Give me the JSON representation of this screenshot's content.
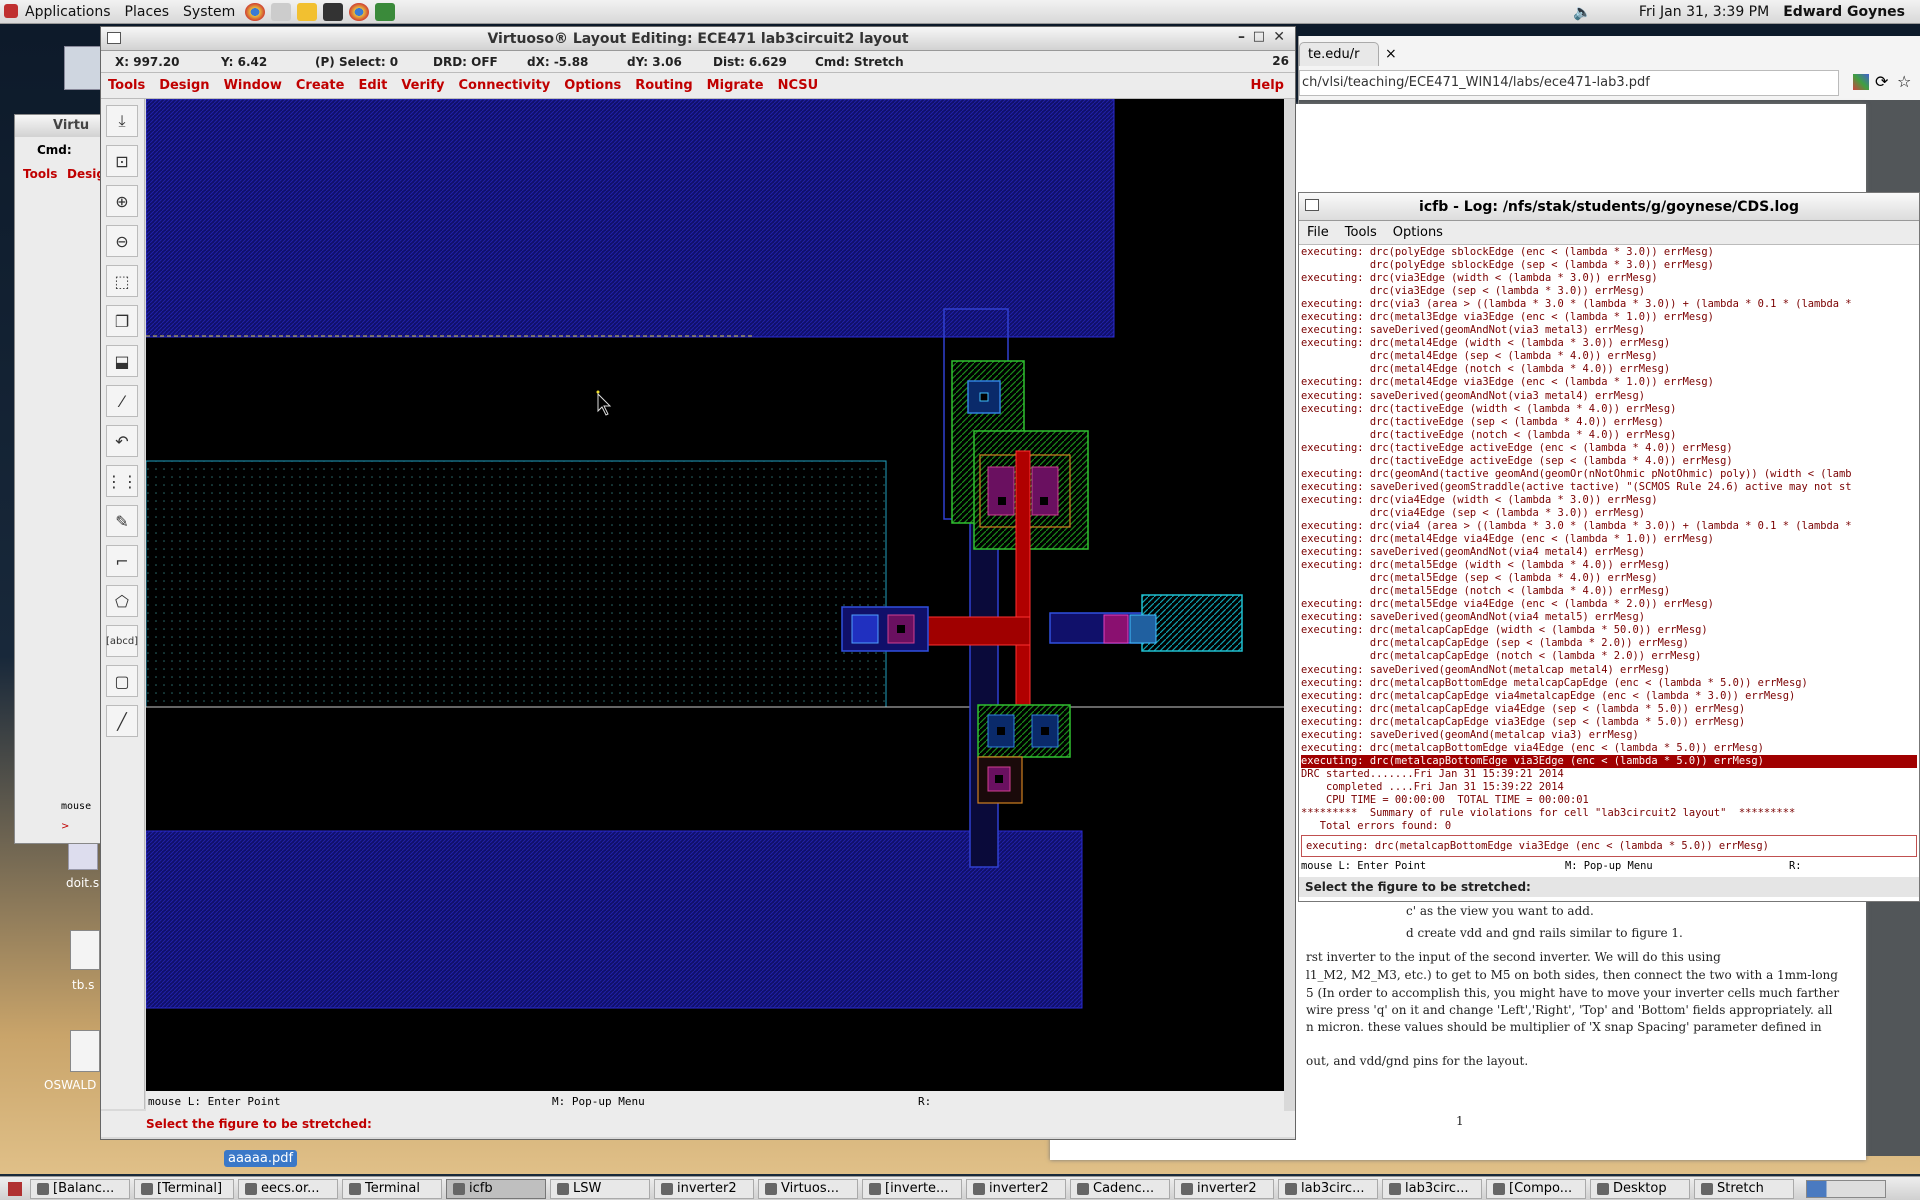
{
  "top_panel": {
    "menus": [
      "Applications",
      "Places",
      "System"
    ],
    "clock": "Fri Jan 31,  3:39 PM",
    "user": "Edward Goynes"
  },
  "browser": {
    "tab_label": "te.edu/r",
    "tab_close": "×",
    "url": "ch/vlsi/teaching/ECE471_WIN14/labs/ece471-lab3.pdf"
  },
  "pdf": {
    "lines": [
      "c' as the view you want to add.",
      "d create vdd and gnd rails similar to figure 1.",
      "rst inverter to the input of the second inverter. We will do this using",
      "l1_M2, M2_M3, etc.) to get to M5 on both sides, then connect the two with a 1mm-long",
      "5 (In order to accomplish this, you might have to move your inverter cells much farther",
      "wire press 'q' on it and change 'Left','Right', 'Top' and 'Bottom' fields appropriately. all",
      "n micron. these values should be multiplier of 'X snap Spacing' parameter defined in",
      "out, and vdd/gnd pins for the layout."
    ],
    "page_number": "1"
  },
  "log_window": {
    "title": "icfb - Log: /nfs/stak/students/g/goynese/CDS.log",
    "menus": [
      "File",
      "Tools",
      "Options"
    ],
    "lines": [
      "executing: drc(polyEdge sblockEdge (enc < (lambda * 3.0)) errMesg)",
      "           drc(polyEdge sblockEdge (sep < (lambda * 3.0)) errMesg)",
      "executing: drc(via3Edge (width < (lambda * 3.0)) errMesg)",
      "           drc(via3Edge (sep < (lambda * 3.0)) errMesg)",
      "executing: drc(via3 (area > ((lambda * 3.0 * (lambda * 3.0)) + (lambda * 0.1 * (lambda *",
      "executing: drc(metal3Edge via3Edge (enc < (lambda * 1.0)) errMesg)",
      "executing: saveDerived(geomAndNot(via3 metal3) errMesg)",
      "executing: drc(metal4Edge (width < (lambda * 3.0)) errMesg)",
      "           drc(metal4Edge (sep < (lambda * 4.0)) errMesg)",
      "           drc(metal4Edge (notch < (lambda * 4.0)) errMesg)",
      "executing: drc(metal4Edge via3Edge (enc < (lambda * 1.0)) errMesg)",
      "executing: saveDerived(geomAndNot(via3 metal4) errMesg)",
      "executing: drc(tactiveEdge (width < (lambda * 4.0)) errMesg)",
      "           drc(tactiveEdge (sep < (lambda * 4.0)) errMesg)",
      "           drc(tactiveEdge (notch < (lambda * 4.0)) errMesg)",
      "executing: drc(tactiveEdge activeEdge (enc < (lambda * 4.0)) errMesg)",
      "           drc(tactiveEdge activeEdge (sep < (lambda * 4.0)) errMesg)",
      "executing: drc(geomAnd(tactive geomAnd(geomOr(nNotOhmic pNotOhmic) poly)) (width < (lamb",
      "executing: saveDerived(geomStraddle(active tactive) \"(SCMOS Rule 24.6) active may not st",
      "executing: drc(via4Edge (width < (lambda * 3.0)) errMesg)",
      "           drc(via4Edge (sep < (lambda * 3.0)) errMesg)",
      "executing: drc(via4 (area > ((lambda * 3.0 * (lambda * 3.0)) + (lambda * 0.1 * (lambda *",
      "executing: drc(metal4Edge via4Edge (enc < (lambda * 1.0)) errMesg)",
      "executing: saveDerived(geomAndNot(via4 metal4) errMesg)",
      "executing: drc(metal5Edge (width < (lambda * 4.0)) errMesg)",
      "           drc(metal5Edge (sep < (lambda * 4.0)) errMesg)",
      "           drc(metal5Edge (notch < (lambda * 4.0)) errMesg)",
      "executing: drc(metal5Edge via4Edge (enc < (lambda * 2.0)) errMesg)",
      "executing: saveDerived(geomAndNot(via4 metal5) errMesg)",
      "executing: drc(metalcapCapEdge (width < (lambda * 50.0)) errMesg)",
      "           drc(metalcapCapEdge (sep < (lambda * 2.0)) errMesg)",
      "           drc(metalcapCapEdge (notch < (lambda * 2.0)) errMesg)",
      "executing: saveDerived(geomAndNot(metalcap metal4) errMesg)",
      "executing: drc(metalcapBottomEdge metalcapCapEdge (enc < (lambda * 5.0)) errMesg)",
      "executing: drc(metalcapCapEdge via4metalcapEdge (enc < (lambda * 3.0)) errMesg)",
      "executing: drc(metalcapCapEdge via4Edge (sep < (lambda * 5.0)) errMesg)",
      "executing: drc(metalcapCapEdge via3Edge (sep < (lambda * 5.0)) errMesg)",
      "executing: saveDerived(geomAnd(metalcap via3) errMesg)",
      "executing: drc(metalcapBottomEdge via4Edge (enc < (lambda * 5.0)) errMesg)"
    ],
    "highlighted_line": "executing: drc(metalcapBottomEdge via3Edge (enc < (lambda * 5.0)) errMesg)",
    "summary_lines": [
      "DRC started.......Fri Jan 31 15:39:21 2014",
      "    completed ....Fri Jan 31 15:39:22 2014",
      "    CPU TIME = 00:00:00  TOTAL TIME = 00:00:01",
      "*********  Summary of rule violations for cell \"lab3circuit2 layout\"  *********",
      "   Total errors found: 0"
    ],
    "input_value": "executing: drc(metalcapBottomEdge via3Edge (enc < (lambda * 5.0)) errMesg)",
    "mouse_l": "mouse L: Enter Point",
    "mouse_m": "M: Pop-up Menu",
    "mouse_r": "R:",
    "prompt": "Select the figure to be stretched:"
  },
  "small_window": {
    "title": "Virtu",
    "cmd_label": "Cmd:",
    "menus": [
      "Tools",
      "Design"
    ],
    "mouse_label": "mouse",
    "prompt_char": ">"
  },
  "virtuoso": {
    "title": "Virtuoso® Layout Editing: ECE471 lab3circuit2 layout",
    "status": {
      "x": "X: 997.20",
      "y": "Y: 6.42",
      "select": "(P) Select: 0",
      "drd": "DRD: OFF",
      "dx": "dX: -5.88",
      "dy": "dY: 3.06",
      "dist": "Dist: 6.629",
      "cmd": "Cmd: Stretch",
      "count": "26"
    },
    "menus": [
      "Tools",
      "Design",
      "Window",
      "Create",
      "Edit",
      "Verify",
      "Connectivity",
      "Options",
      "Routing",
      "Migrate",
      "NCSU"
    ],
    "help": "Help",
    "mouse_l": "mouse L: Enter Point",
    "mouse_m": "M: Pop-up Menu",
    "mouse_r": "R:",
    "prompt": "Select the figure to be stretched:",
    "toolbar_labels": {
      "label_tool": "[abcd]"
    }
  },
  "desktop_icons": [
    {
      "label": "doit.s"
    },
    {
      "label": "tb.s"
    },
    {
      "label": "OSWALD"
    },
    {
      "label": "aaaaa.pdf"
    }
  ],
  "taskbar": [
    {
      "label": "[Balanc..."
    },
    {
      "label": "[Terminal]"
    },
    {
      "label": "eecs.or..."
    },
    {
      "label": "Terminal"
    },
    {
      "label": "icfb"
    },
    {
      "label": "LSW"
    },
    {
      "label": "inverter2"
    },
    {
      "label": "Virtuos..."
    },
    {
      "label": "[inverte..."
    },
    {
      "label": "inverter2"
    },
    {
      "label": "Cadenc..."
    },
    {
      "label": "inverter2"
    },
    {
      "label": "lab3circ..."
    },
    {
      "label": "lab3circ..."
    },
    {
      "label": "[Compo..."
    },
    {
      "label": "Desktop"
    },
    {
      "label": "Stretch"
    }
  ],
  "colors": {
    "metal1_blue": "#1a1aa0",
    "poly_red": "#c00000",
    "active_green": "#22aa22",
    "menu_red": "#c00000",
    "log_text": "#7a0000"
  }
}
